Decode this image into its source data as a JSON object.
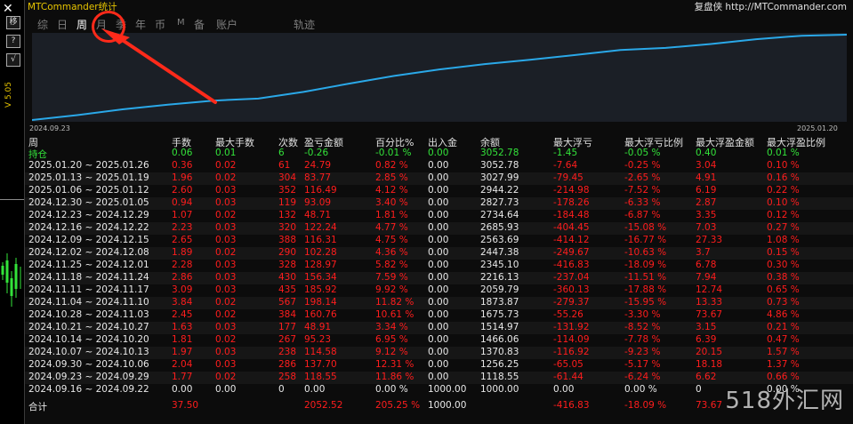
{
  "window": {
    "title": "MTCommander统计",
    "brand": "复盘侠 http://MTCommander.com"
  },
  "left_strip": {
    "close": "✕",
    "buttons": [
      "移",
      "?",
      "√"
    ],
    "version": "V 5.05"
  },
  "tabs": [
    {
      "label": "综",
      "active": false
    },
    {
      "label": "日",
      "active": false
    },
    {
      "label": "周",
      "active": true
    },
    {
      "label": "月",
      "active": false
    },
    {
      "label": "季",
      "active": false
    },
    {
      "label": "年",
      "active": false
    },
    {
      "label": "币",
      "active": false
    },
    {
      "label": "M",
      "active": false
    },
    {
      "label": "备",
      "active": false
    },
    {
      "label": "账户",
      "active": false
    }
  ],
  "chart": {
    "label": "轨迹",
    "x_start": "2024.09.23",
    "x_end": "2025.01.20",
    "line_color": "#2aa8e8",
    "balance_series": [
      1000.0,
      1118.55,
      1256.25,
      1370.83,
      1466.06,
      1514.97,
      1675.73,
      1873.87,
      2059.79,
      2216.13,
      2345.1,
      2447.38,
      2563.69,
      2685.93,
      2734.64,
      2827.73,
      2944.22,
      3027.99,
      3052.78
    ]
  },
  "table": {
    "headers": [
      "周",
      "手数",
      "最大手数",
      "次数",
      "盈亏金额",
      "百分比%",
      "出入金",
      "余额",
      "最大浮亏",
      "最大浮亏比例",
      "最大浮盈金额",
      "最大浮盈比例"
    ],
    "holding": [
      "持仓",
      "0.06",
      "0.01",
      "6",
      "-0.26",
      "-0.01 %",
      "0.00",
      "3052.78",
      "-1.45",
      "-0.05 %",
      "0.40",
      "0.01 %"
    ],
    "rows": [
      [
        "2025.01.20 ~ 2025.01.26",
        "0.36",
        "0.02",
        "61",
        "24.79",
        "0.82 %",
        "0.00",
        "3052.78",
        "-7.64",
        "-0.25 %",
        "3.04",
        "0.10 %"
      ],
      [
        "2025.01.13 ~ 2025.01.19",
        "1.96",
        "0.02",
        "304",
        "83.77",
        "2.85 %",
        "0.00",
        "3027.99",
        "-79.45",
        "-2.65 %",
        "4.91",
        "0.16 %"
      ],
      [
        "2025.01.06 ~ 2025.01.12",
        "2.60",
        "0.03",
        "352",
        "116.49",
        "4.12 %",
        "0.00",
        "2944.22",
        "-214.98",
        "-7.52 %",
        "6.19",
        "0.22 %"
      ],
      [
        "2024.12.30 ~ 2025.01.05",
        "0.94",
        "0.03",
        "119",
        "93.09",
        "3.40 %",
        "0.00",
        "2827.73",
        "-178.26",
        "-6.33 %",
        "2.87",
        "0.10 %"
      ],
      [
        "2024.12.23 ~ 2024.12.29",
        "1.07",
        "0.02",
        "132",
        "48.71",
        "1.81 %",
        "0.00",
        "2734.64",
        "-184.48",
        "-6.87 %",
        "3.35",
        "0.12 %"
      ],
      [
        "2024.12.16 ~ 2024.12.22",
        "2.23",
        "0.03",
        "320",
        "122.24",
        "4.77 %",
        "0.00",
        "2685.93",
        "-404.45",
        "-15.08 %",
        "7.03",
        "0.27 %"
      ],
      [
        "2024.12.09 ~ 2024.12.15",
        "2.65",
        "0.03",
        "388",
        "116.31",
        "4.75 %",
        "0.00",
        "2563.69",
        "-414.12",
        "-16.77 %",
        "27.33",
        "1.08 %"
      ],
      [
        "2024.12.02 ~ 2024.12.08",
        "1.89",
        "0.02",
        "290",
        "102.28",
        "4.36 %",
        "0.00",
        "2447.38",
        "-249.67",
        "-10.63 %",
        "3.7",
        "0.15 %"
      ],
      [
        "2024.11.25 ~ 2024.12.01",
        "2.28",
        "0.03",
        "328",
        "128.97",
        "5.82 %",
        "0.00",
        "2345.10",
        "-416.83",
        "-18.09 %",
        "6.78",
        "0.30 %"
      ],
      [
        "2024.11.18 ~ 2024.11.24",
        "2.86",
        "0.03",
        "430",
        "156.34",
        "7.59 %",
        "0.00",
        "2216.13",
        "-237.04",
        "-11.51 %",
        "7.94",
        "0.38 %"
      ],
      [
        "2024.11.11 ~ 2024.11.17",
        "3.09",
        "0.03",
        "435",
        "185.92",
        "9.92 %",
        "0.00",
        "2059.79",
        "-360.13",
        "-17.88 %",
        "12.74",
        "0.65 %"
      ],
      [
        "2024.11.04 ~ 2024.11.10",
        "3.84",
        "0.02",
        "567",
        "198.14",
        "11.82 %",
        "0.00",
        "1873.87",
        "-279.37",
        "-15.95 %",
        "13.33",
        "0.73 %"
      ],
      [
        "2024.10.28 ~ 2024.11.03",
        "2.45",
        "0.02",
        "384",
        "160.76",
        "10.61 %",
        "0.00",
        "1675.73",
        "-55.26",
        "-3.30 %",
        "73.67",
        "4.86 %"
      ],
      [
        "2024.10.21 ~ 2024.10.27",
        "1.63",
        "0.03",
        "177",
        "48.91",
        "3.34 %",
        "0.00",
        "1514.97",
        "-131.92",
        "-8.52 %",
        "3.15",
        "0.21 %"
      ],
      [
        "2024.10.14 ~ 2024.10.20",
        "1.81",
        "0.02",
        "267",
        "95.23",
        "6.95 %",
        "0.00",
        "1466.06",
        "-114.09",
        "-7.78 %",
        "6.39",
        "0.47 %"
      ],
      [
        "2024.10.07 ~ 2024.10.13",
        "1.97",
        "0.03",
        "238",
        "114.58",
        "9.12 %",
        "0.00",
        "1370.83",
        "-116.92",
        "-9.23 %",
        "20.15",
        "1.57 %"
      ],
      [
        "2024.09.30 ~ 2024.10.06",
        "2.04",
        "0.03",
        "286",
        "137.70",
        "12.31 %",
        "0.00",
        "1256.25",
        "-65.05",
        "-5.17 %",
        "18.18",
        "1.37 %"
      ],
      [
        "2024.09.23 ~ 2024.09.29",
        "1.77",
        "0.02",
        "258",
        "118.55",
        "11.86 %",
        "0.00",
        "1118.55",
        "-61.44",
        "-6.24 %",
        "6.62",
        "0.66 %"
      ]
    ],
    "initial_row": [
      "2024.09.16 ~ 2024.09.22",
      "0.00",
      "0.00",
      "0",
      "0.00",
      "0.00 %",
      "1000.00",
      "1000.00",
      "0.00",
      "0.00 %",
      "0",
      "0.00 %"
    ],
    "total_row": [
      "合计",
      "37.50",
      "",
      "",
      "2052.52",
      "205.25 %",
      "1000.00",
      "",
      "-416.83",
      "-18.09 %",
      "73.67",
      ""
    ]
  },
  "watermark": "518外汇网"
}
